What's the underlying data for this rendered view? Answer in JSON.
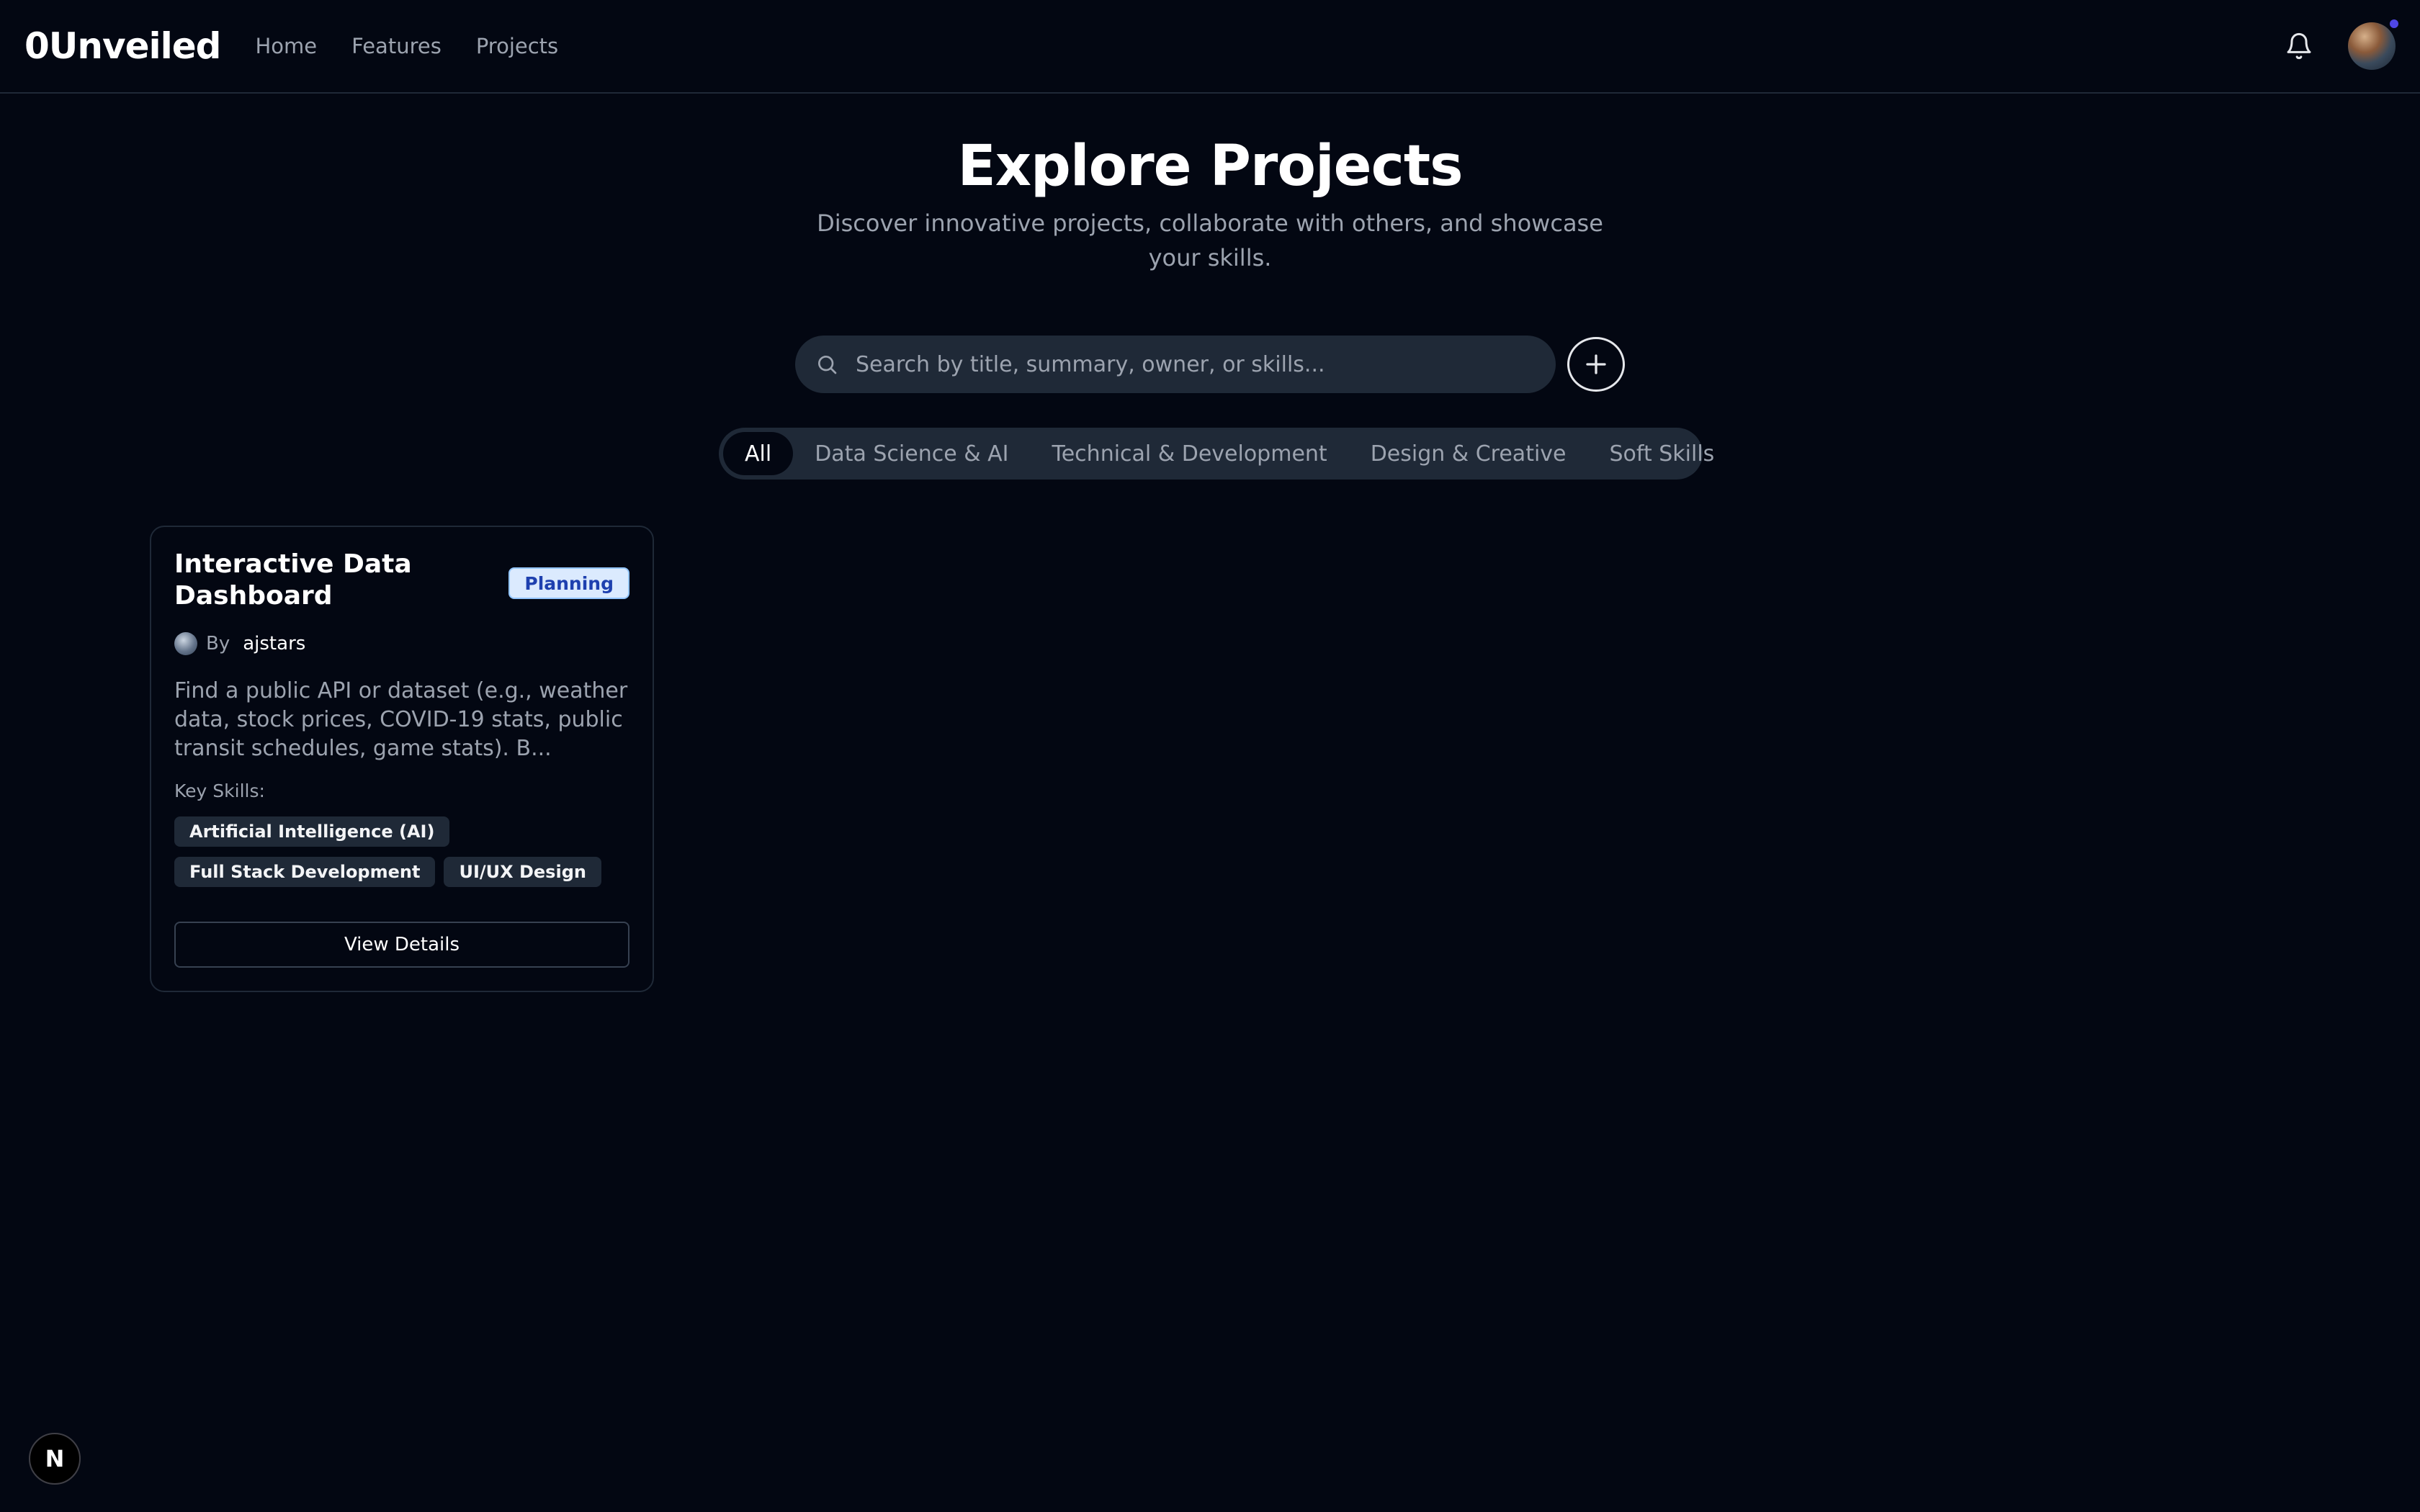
{
  "header": {
    "logo": "0Unveiled",
    "nav": [
      {
        "label": "Home"
      },
      {
        "label": "Features"
      },
      {
        "label": "Projects"
      }
    ],
    "bell_icon": "bell-icon",
    "avatar_icon": "user-avatar"
  },
  "hero": {
    "title": "Explore Projects",
    "subtitle": "Discover innovative projects, collaborate with others, and showcase your skills."
  },
  "search": {
    "placeholder": "Search by title, summary, owner, or skills...",
    "value": ""
  },
  "tabs": [
    {
      "label": "All",
      "active": true
    },
    {
      "label": "Data Science & AI",
      "active": false
    },
    {
      "label": "Technical & Development",
      "active": false
    },
    {
      "label": "Design & Creative",
      "active": false
    },
    {
      "label": "Soft Skills",
      "active": false
    }
  ],
  "projects": [
    {
      "title": "Interactive Data Dashboard",
      "status": "Planning",
      "by_label": "By",
      "owner": "ajstars",
      "description": "Find a public API or dataset (e.g., weather data, stock prices, COVID-19 stats, public transit schedules, game stats). B...",
      "skills_label": "Key Skills:",
      "skills": [
        "Artificial Intelligence (AI)",
        "Full Stack Development",
        "UI/UX Design"
      ],
      "action_label": "View Details"
    }
  ],
  "dev_badge": {
    "label": "N"
  },
  "colors": {
    "background": "#030712",
    "surface": "#1f2937",
    "status_badge_bg": "#dbeafe",
    "status_badge_text": "#1e40af",
    "notification_dot": "#4f46e5"
  }
}
